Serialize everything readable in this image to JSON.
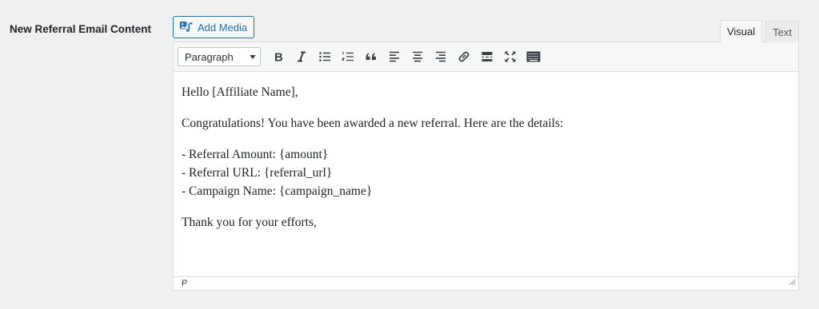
{
  "field": {
    "label": "New Referral Email Content"
  },
  "media": {
    "button_label": "Add Media",
    "icon": "media-icon"
  },
  "tabs": [
    {
      "label": "Visual",
      "active": true
    },
    {
      "label": "Text",
      "active": false
    }
  ],
  "toolbar": {
    "format_value": "Paragraph",
    "buttons": [
      "bold-icon",
      "italic-icon",
      "bullet-list-icon",
      "numbered-list-icon",
      "blockquote-icon",
      "align-left-icon",
      "align-center-icon",
      "align-right-icon",
      "link-icon",
      "read-more-icon",
      "fullscreen-icon",
      "toolbar-toggle-icon"
    ]
  },
  "content": {
    "greeting": "Hello [Affiliate Name],",
    "intro": "Congratulations! You have been awarded a new referral. Here are the details:",
    "details": [
      "- Referral Amount: {amount}",
      "- Referral URL: {referral_url}",
      "- Campaign Name: {campaign_name}"
    ],
    "closing": "Thank you for your efforts,"
  },
  "status": {
    "path": "P"
  },
  "colors": {
    "accent": "#2271b1",
    "background": "#f0f0f1",
    "border": "#dcdcde"
  }
}
